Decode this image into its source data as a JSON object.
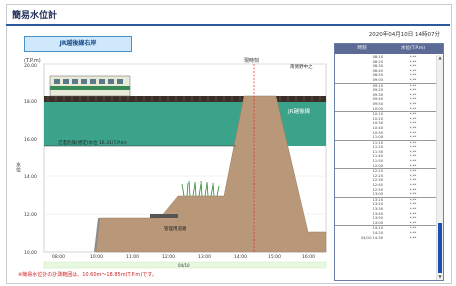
{
  "header": {
    "title": "簡易水位計",
    "timestamp": "2020年04月10日 14時07分"
  },
  "station": {
    "label": "JR越後線右岸"
  },
  "chart": {
    "y_unit": "(T.P.m)",
    "y_axis_label": "水位",
    "y_ticks": [
      "20.00",
      "18.00",
      "16.00",
      "14.00",
      "12.00",
      "10.00"
    ],
    "x_ticks": [
      "08:00",
      "10:00",
      "11:00",
      "12:00",
      "13:00",
      "14:00",
      "15:00",
      "16:00"
    ],
    "current_time_label": "現時刻",
    "upstream_label": "南側野中之",
    "bridge_label": "JR越後線",
    "road_label": "管理用道路",
    "threshold_label": "氾濫危険(想定)水位 16.31(T.P.m)",
    "date_label": "04/10",
    "colors": {
      "water": "#3aa38a",
      "embankment": "#b9987a",
      "redline": "#e22"
    }
  },
  "table": {
    "col_time": "時刻",
    "col_level": "水位(T.P.m)",
    "rows": [
      {
        "t": "08:10",
        "v": "*.**"
      },
      {
        "t": "08:20",
        "v": "*.**"
      },
      {
        "t": "08:30",
        "v": "*.**"
      },
      {
        "t": "08:40",
        "v": "*.**"
      },
      {
        "t": "08:50",
        "v": "*.**"
      },
      {
        "t": "09:00",
        "v": "*.**"
      },
      {
        "t": "09:10",
        "v": "*.**"
      },
      {
        "t": "09:20",
        "v": "*.**"
      },
      {
        "t": "09:30",
        "v": "*.**"
      },
      {
        "t": "09:40",
        "v": "*.**"
      },
      {
        "t": "09:50",
        "v": "*.**"
      },
      {
        "t": "10:00",
        "v": "*.**"
      },
      {
        "t": "10:10",
        "v": "*.**"
      },
      {
        "t": "10:20",
        "v": "*.**"
      },
      {
        "t": "10:30",
        "v": "*.**"
      },
      {
        "t": "10:40",
        "v": "*.**"
      },
      {
        "t": "10:50",
        "v": "*.**"
      },
      {
        "t": "11:00",
        "v": "*.**"
      },
      {
        "t": "11:10",
        "v": "*.**"
      },
      {
        "t": "11:20",
        "v": "*.**"
      },
      {
        "t": "11:30",
        "v": "*.**"
      },
      {
        "t": "11:40",
        "v": "*.**"
      },
      {
        "t": "11:50",
        "v": "*.**"
      },
      {
        "t": "12:00",
        "v": "*.**"
      },
      {
        "t": "12:10",
        "v": "*.**"
      },
      {
        "t": "12:20",
        "v": "*.**"
      },
      {
        "t": "12:30",
        "v": "*.**"
      },
      {
        "t": "12:40",
        "v": "*.**"
      },
      {
        "t": "12:50",
        "v": "*.**"
      },
      {
        "t": "13:00",
        "v": "*.**"
      },
      {
        "t": "13:10",
        "v": "*.**"
      },
      {
        "t": "13:20",
        "v": "*.**"
      },
      {
        "t": "13:30",
        "v": "*.**"
      },
      {
        "t": "13:40",
        "v": "*.**"
      },
      {
        "t": "13:50",
        "v": "*.**"
      },
      {
        "t": "14:00",
        "v": "*.**"
      },
      {
        "t": "14:10",
        "v": "*.**"
      },
      {
        "t": "14:20",
        "v": "*.**"
      },
      {
        "t": "04/10 14:30",
        "v": "*.**"
      }
    ]
  },
  "footnote": "※簡易水位計の計測範囲は、10.60m〜18.85m(T.P.m)です。"
}
